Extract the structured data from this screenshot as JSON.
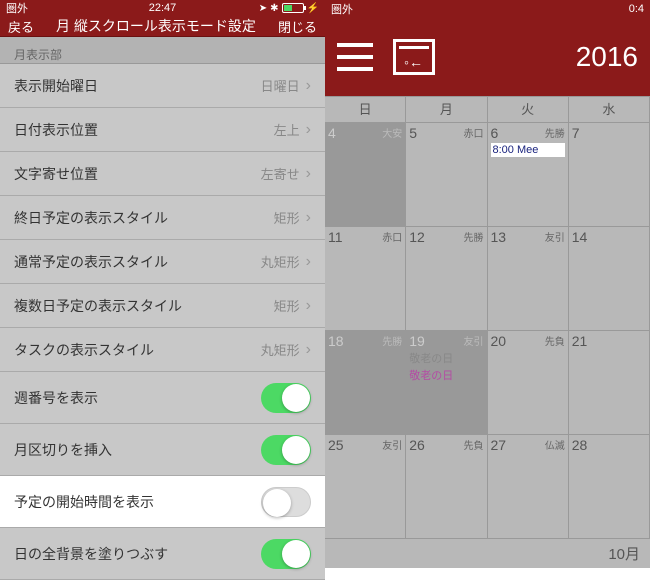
{
  "left": {
    "status": {
      "carrier": "圏外",
      "time": "22:47",
      "icons": "➤ ⁕ ✱"
    },
    "nav": {
      "back": "戻る",
      "title": "月 縦スクロール表示モード設定",
      "close": "閉じる"
    },
    "section": "月表示部",
    "rows": [
      {
        "label": "表示開始曜日",
        "value": "日曜日",
        "type": "chev"
      },
      {
        "label": "日付表示位置",
        "value": "左上",
        "type": "chev"
      },
      {
        "label": "文字寄せ位置",
        "value": "左寄せ",
        "type": "chev"
      },
      {
        "label": "終日予定の表示スタイル",
        "value": "矩形",
        "type": "chev"
      },
      {
        "label": "通常予定の表示スタイル",
        "value": "丸矩形",
        "type": "chev"
      },
      {
        "label": "複数日予定の表示スタイル",
        "value": "矩形",
        "type": "chev"
      },
      {
        "label": "タスクの表示スタイル",
        "value": "丸矩形",
        "type": "chev"
      },
      {
        "label": "週番号を表示",
        "type": "toggle",
        "on": true
      },
      {
        "label": "月区切りを挿入",
        "type": "toggle",
        "on": true
      },
      {
        "label": "予定の開始時間を表示",
        "type": "toggle",
        "on": false,
        "hl": true
      },
      {
        "label": "日の全背景を塗りつぶす",
        "type": "toggle",
        "on": true
      }
    ]
  },
  "right": {
    "status": {
      "carrier": "圏外",
      "time": "0:4"
    },
    "year": "2016",
    "dayhdr": [
      "日",
      "月",
      "火",
      "水"
    ],
    "weeks": [
      [
        {
          "d": "4",
          "rk": "大安",
          "past": true
        },
        {
          "d": "5",
          "rk": "赤口"
        },
        {
          "d": "6",
          "rk": "先勝",
          "evt": "8:00 Mee"
        },
        {
          "d": "7"
        }
      ],
      [
        {
          "d": "11",
          "rk": "赤口"
        },
        {
          "d": "12",
          "rk": "先勝"
        },
        {
          "d": "13",
          "rk": "友引"
        },
        {
          "d": "14"
        }
      ],
      [
        {
          "d": "18",
          "rk": "先勝",
          "past": true
        },
        {
          "d": "19",
          "rk": "友引",
          "past": true,
          "hols": [
            {
              "t": "敬老の日",
              "c": "g"
            },
            {
              "t": "敬老の日",
              "c": "p"
            }
          ]
        },
        {
          "d": "20",
          "rk": "先負"
        },
        {
          "d": "21"
        }
      ],
      [
        {
          "d": "25",
          "rk": "友引"
        },
        {
          "d": "26",
          "rk": "先負"
        },
        {
          "d": "27",
          "rk": "仏滅"
        },
        {
          "d": "28"
        }
      ]
    ],
    "monthLabel": "10月"
  }
}
